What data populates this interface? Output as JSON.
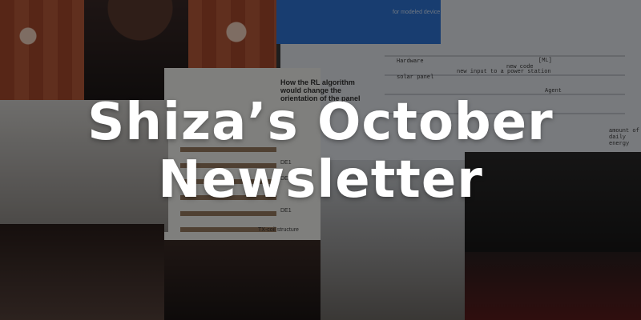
{
  "headline": {
    "line1": "Shiza’s October",
    "line2": "Newsletter"
  },
  "collage_text": {
    "rl_question": "How the RL algorithm would change the orientation of the panel",
    "slide_caption": "for modeled device",
    "whiteboard": {
      "label1": "Hardware",
      "label2": "solar panel",
      "label3": "new input to a power station",
      "label4": "new code",
      "label5": "[ML]",
      "label6": "Agent",
      "label7": "amount of daily energy"
    },
    "paper": {
      "de1": "DE1",
      "de2": "DE2",
      "de3": "DE1",
      "tx": "TX-coil structure"
    }
  },
  "colors": {
    "headline": "#ffffff",
    "overlay": "rgba(0,0,0,0.48)"
  }
}
